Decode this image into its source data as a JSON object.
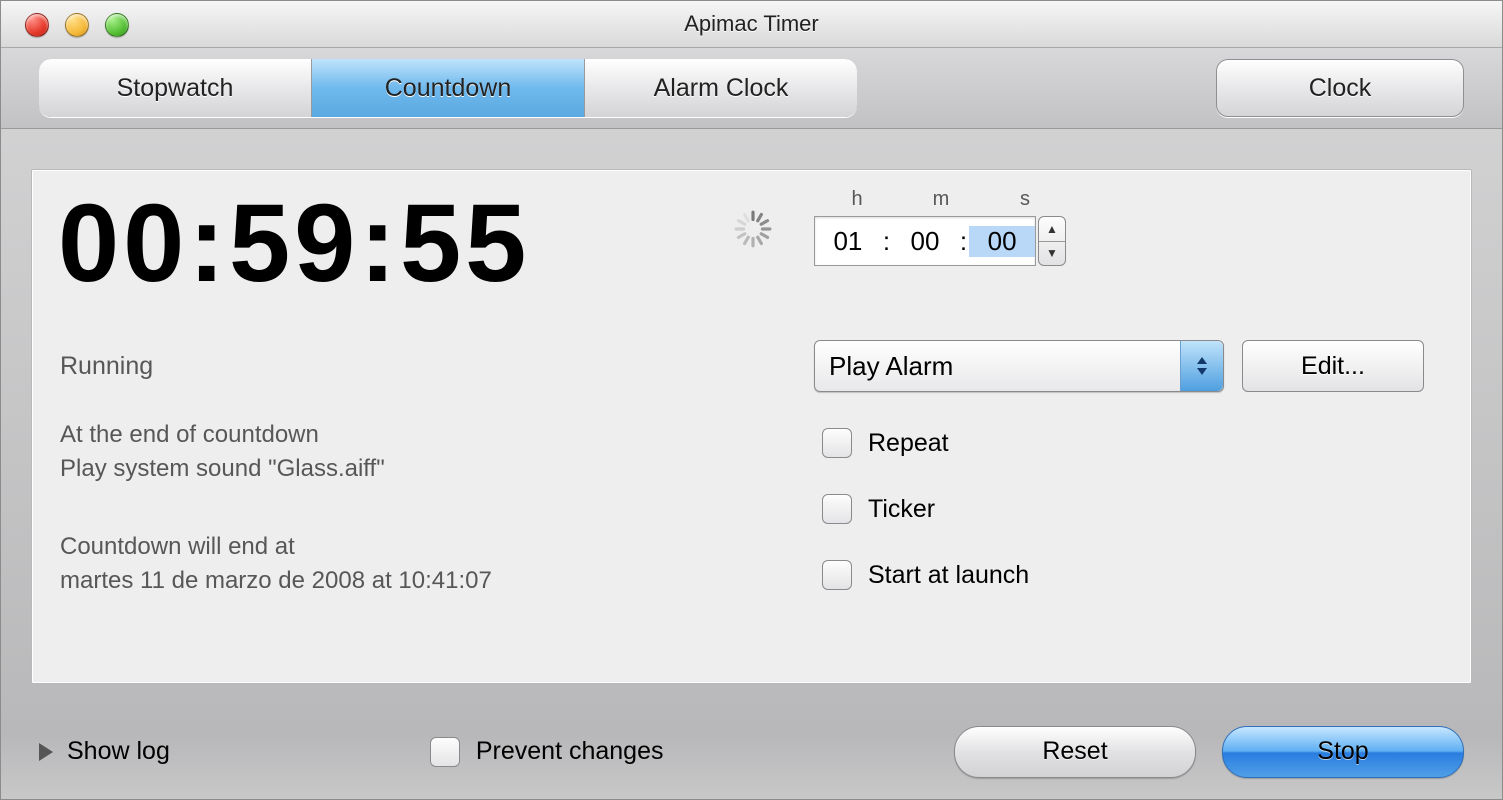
{
  "window": {
    "title": "Apimac Timer"
  },
  "traffic": {
    "close": "close-icon",
    "min": "minimize-icon",
    "zoom": "zoom-icon"
  },
  "tabs": {
    "items": [
      {
        "label": "Stopwatch",
        "active": false
      },
      {
        "label": "Countdown",
        "active": true
      },
      {
        "label": "Alarm Clock",
        "active": false
      }
    ],
    "clock_label": "Clock"
  },
  "display": {
    "time": "00:59:55"
  },
  "status": {
    "text": "Running"
  },
  "info": {
    "end_action_line1": "At the end of countdown",
    "end_action_line2": "Play system sound \"Glass.aiff\"",
    "end_time_line1": "Countdown will end at",
    "end_time_line2": "martes 11 de marzo de 2008 at 10:41:07"
  },
  "hms": {
    "labels": {
      "h": "h",
      "m": "m",
      "s": "s"
    },
    "values": {
      "h": "01",
      "m": "00",
      "s": "00"
    },
    "selected": "s"
  },
  "action": {
    "popup_selected": "Play Alarm",
    "edit_label": "Edit..."
  },
  "options": {
    "repeat": {
      "label": "Repeat",
      "checked": false
    },
    "ticker": {
      "label": "Ticker",
      "checked": false
    },
    "start_at_launch": {
      "label": "Start at launch",
      "checked": false
    }
  },
  "footer": {
    "show_log": "Show log",
    "prevent_changes": {
      "label": "Prevent changes",
      "checked": false
    },
    "reset": "Reset",
    "stop": "Stop"
  }
}
